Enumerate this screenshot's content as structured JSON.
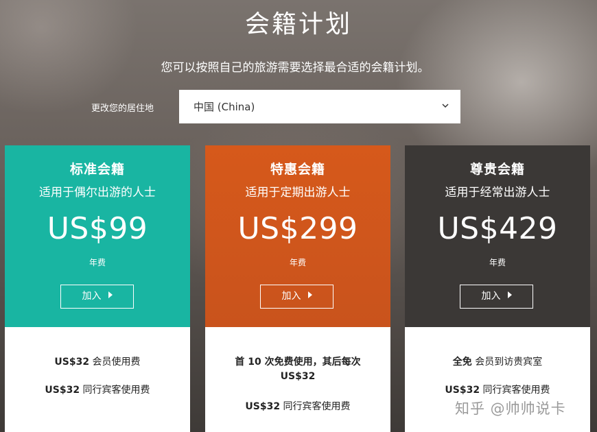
{
  "page": {
    "title": "会籍计划",
    "subtitle": "您可以按照自己的旅游需要选择最合适的会籍计划。"
  },
  "residence": {
    "label": "更改您的居住地",
    "selected": "中国 (China)"
  },
  "plans": [
    {
      "name": "标准会籍",
      "tagline": "适用于偶尔出游的人士",
      "price": "US$99",
      "period": "年费",
      "cta": "加入",
      "color": "#17b3a0",
      "features": [
        {
          "strong": "US$32",
          "text": " 会员使用费"
        },
        {
          "strong": "US$32",
          "text": " 同行宾客使用费"
        }
      ]
    },
    {
      "name": "特惠会籍",
      "tagline": "适用于定期出游人士",
      "price": "US$299",
      "period": "年费",
      "cta": "加入",
      "color": "#d45a1c",
      "features": [
        {
          "strong": "首 10 次免费使用，其后每次",
          "text": ""
        },
        {
          "strong": "US$32",
          "text": ""
        },
        {
          "strong": "US$32",
          "text": " 同行宾客使用费"
        }
      ]
    },
    {
      "name": "尊贵会籍",
      "tagline": "适用于经常出游人士",
      "price": "US$429",
      "period": "年费",
      "cta": "加入",
      "color": "#3a3735",
      "features": [
        {
          "strong": "全免",
          "text": " 会员到访贵宾室"
        },
        {
          "strong": "US$32",
          "text": " 同行宾客使用费"
        }
      ]
    }
  ],
  "watermark": "知乎 @帅帅说卡"
}
